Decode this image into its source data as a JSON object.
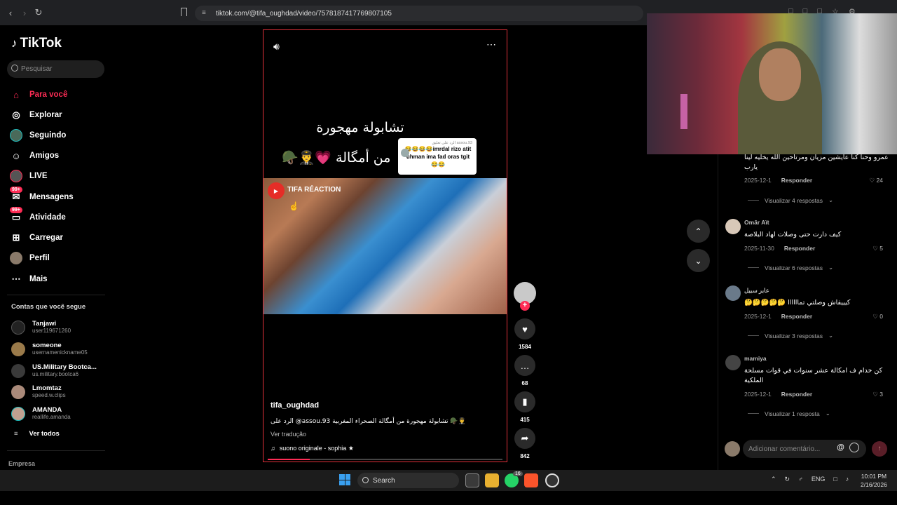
{
  "browser": {
    "url": "tiktok.com/@tifa_oughdad/video/7578187417769807105"
  },
  "sidebar": {
    "logo": "TikTok",
    "search_placeholder": "Pesquisar",
    "items": [
      {
        "label": "Para você",
        "icon": "home-icon",
        "active": true
      },
      {
        "label": "Explorar",
        "icon": "compass-icon"
      },
      {
        "label": "Seguindo",
        "icon": "following-icon"
      },
      {
        "label": "Amigos",
        "icon": "friends-icon"
      },
      {
        "label": "LIVE",
        "icon": "live-icon"
      },
      {
        "label": "Mensagens",
        "icon": "messages-icon",
        "badge": "99+"
      },
      {
        "label": "Atividade",
        "icon": "activity-icon",
        "badge": "99+"
      },
      {
        "label": "Carregar",
        "icon": "upload-icon"
      },
      {
        "label": "Perfil",
        "icon": "profile-icon"
      },
      {
        "label": "Mais",
        "icon": "more-icon"
      }
    ],
    "following_title": "Contas que você segue",
    "following": [
      {
        "name": "Tanjawi",
        "user": "user119671260"
      },
      {
        "name": "someone",
        "user": "usernamenickname05"
      },
      {
        "name": "US.Military Bootca...",
        "user": "us.military.bootca6"
      },
      {
        "name": "Lmomtaz",
        "user": "speed.w.clips"
      },
      {
        "name": "AMANDA",
        "user": "reallife.amanda"
      }
    ],
    "see_all": "Ver todos",
    "company": "Empresa"
  },
  "video": {
    "overlay_line1": "تشابولة مهجورة",
    "overlay_line2": "من أمگالة 💗👨‍✈️🪖",
    "reply_bubble_header": "الرد على تعليق assou.93",
    "reply_bubble_text": "😂😂😂😂imrdal rizo atit uhman ima fad oras tgit 😂😂",
    "channel_label": "TIFA RÉACTION",
    "author": "tifa_oughdad",
    "description": "الرد على @assou.93 تشابولة مهجورة من أمگالة الصحراء المغربية 🪖👨‍✈️",
    "see_translation": "Ver tradução",
    "music": "suono originale - sophia ★",
    "progress": 0.18
  },
  "actions": {
    "likes": "1584",
    "comments": "68",
    "saves": "415",
    "shares": "842"
  },
  "comments": [
    {
      "name": "",
      "text": "عمرو وحنا كنا عايشين مزيان ومرتاحين الله يخليه لينا يارب",
      "date": "2025-12-1",
      "reply_label": "Responder",
      "likes": "24",
      "replies": "Visualizar 4 respostas"
    },
    {
      "name": "Omār Aït",
      "text": "كيف دارت حتى وصلات لهاد البلاصة",
      "date": "2025-11-30",
      "reply_label": "Responder",
      "likes": "5",
      "replies": "Visualizar 6 respostas"
    },
    {
      "name": "عابر سبيل",
      "text": "كيييفاش وصلتي تماااااا 🤔🤔🤔🤔🤔",
      "date": "2025-12-1",
      "reply_label": "Responder",
      "likes": "0",
      "replies": "Visualizar 3 respostas"
    },
    {
      "name": "mamiya",
      "text": "كن خدام ف امكالة عشر سنوات في قوات مسلحة الملكية",
      "date": "2025-12-1",
      "reply_label": "Responder",
      "likes": "3",
      "replies": "Visualizar 1 resposta"
    }
  ],
  "add_comment_placeholder": "Adicionar comentário...",
  "taskbar": {
    "search": "Search",
    "lang": "ENG",
    "time": "10:01 PM",
    "date": "2/16/2026",
    "whatsapp_badge": "16"
  },
  "colors": {
    "accent": "#fe2c55",
    "video_border": "#e0303a"
  }
}
